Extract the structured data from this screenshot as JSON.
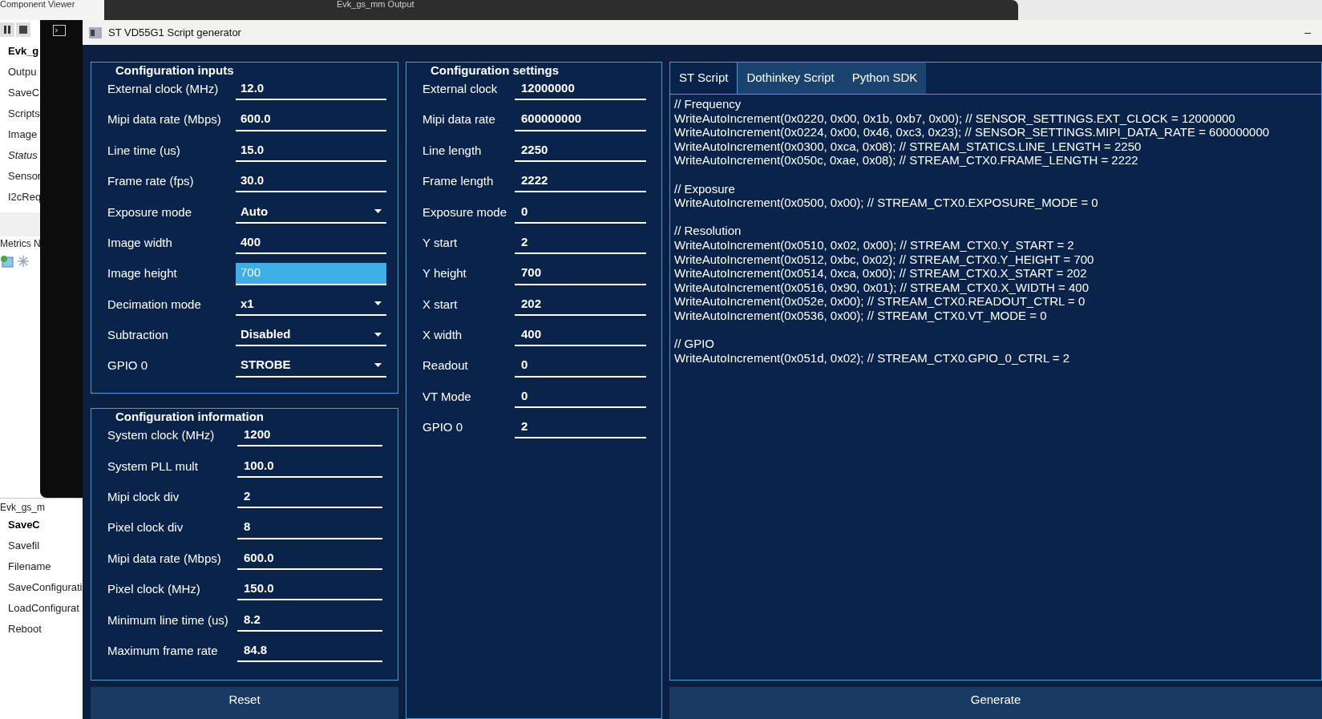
{
  "background_app": {
    "title": "Component Viewer",
    "output_title": "Evk_gs_mm Output",
    "tree_top": [
      {
        "label": "Evk_g",
        "kind": "group"
      },
      {
        "label": "Outpu",
        "kind": "item"
      },
      {
        "label": "SaveC",
        "kind": "item"
      },
      {
        "label": "Scripts",
        "kind": "item"
      },
      {
        "label": "Image",
        "kind": "item"
      },
      {
        "label": "Status",
        "kind": "italic"
      },
      {
        "label": "Sensor",
        "kind": "item"
      },
      {
        "label": "I2cReq",
        "kind": "item"
      }
    ],
    "metrics_title": "Metrics N",
    "tree_bottom_title": "Evk_gs_m",
    "tree_bottom": [
      {
        "label": "SaveC",
        "kind": "group"
      },
      {
        "label": "Savefil",
        "kind": "item"
      },
      {
        "label": "Filename",
        "kind": "item"
      },
      {
        "label": "SaveConfigurati",
        "kind": "item"
      },
      {
        "label": "LoadConfigurat",
        "kind": "item"
      },
      {
        "label": "Reboot",
        "kind": "item"
      }
    ]
  },
  "window": {
    "title": "ST VD55G1 Script generator",
    "minimize": "–"
  },
  "configuration_inputs": {
    "title": "Configuration inputs",
    "rows": [
      {
        "label": "External clock (MHz)",
        "value": "12.0",
        "kind": "text",
        "focused": false
      },
      {
        "label": "Mipi data rate (Mbps)",
        "value": "600.0",
        "kind": "text",
        "focused": false
      },
      {
        "label": "Line time (us)",
        "value": "15.0",
        "kind": "text",
        "focused": false
      },
      {
        "label": "Frame rate (fps)",
        "value": "30.0",
        "kind": "text",
        "focused": false
      },
      {
        "label": "Exposure mode",
        "value": "Auto",
        "kind": "dropdown",
        "focused": false
      },
      {
        "label": "Image width",
        "value": "400",
        "kind": "text",
        "focused": false
      },
      {
        "label": "Image height",
        "value": "700",
        "kind": "text",
        "focused": true
      },
      {
        "label": "Decimation mode",
        "value": "x1",
        "kind": "dropdown",
        "focused": false
      },
      {
        "label": "Subtraction",
        "value": "Disabled",
        "kind": "dropdown",
        "focused": false
      },
      {
        "label": "GPIO 0",
        "value": "STROBE",
        "kind": "dropdown",
        "focused": false
      }
    ]
  },
  "configuration_information": {
    "title": "Configuration information",
    "rows": [
      {
        "label": "System clock (MHz)",
        "value": "1200"
      },
      {
        "label": "System PLL mult",
        "value": "100.0"
      },
      {
        "label": "Mipi clock div",
        "value": "2"
      },
      {
        "label": "Pixel clock div",
        "value": "8"
      },
      {
        "label": "Mipi data rate (Mbps)",
        "value": "600.0"
      },
      {
        "label": "Pixel clock (MHz)",
        "value": "150.0"
      },
      {
        "label": "Minimum line time (us)",
        "value": "8.2"
      },
      {
        "label": "Maximum frame rate",
        "value": "84.8"
      }
    ]
  },
  "reset_button": "Reset",
  "configuration_settings": {
    "title": "Configuration settings",
    "rows": [
      {
        "label": "External clock",
        "value": "12000000"
      },
      {
        "label": "Mipi data rate",
        "value": "600000000"
      },
      {
        "label": "Line length",
        "value": "2250"
      },
      {
        "label": "Frame length",
        "value": "2222"
      },
      {
        "label": "Exposure mode",
        "value": "0"
      },
      {
        "label": "Y start",
        "value": "2"
      },
      {
        "label": "Y height",
        "value": "700"
      },
      {
        "label": "X start",
        "value": "202"
      },
      {
        "label": "X width",
        "value": "400"
      },
      {
        "label": "Readout",
        "value": "0"
      },
      {
        "label": "VT Mode",
        "value": "0"
      },
      {
        "label": "GPIO 0",
        "value": "2"
      }
    ]
  },
  "tabs": [
    {
      "label": "ST Script",
      "selected": true
    },
    {
      "label": "Dothinkey Script",
      "selected": false
    },
    {
      "label": "Python SDK",
      "selected": false
    }
  ],
  "script": [
    {
      "lines": [
        "// Frequency",
        "WriteAutoIncrement(0x0220, 0x00, 0x1b, 0xb7, 0x00); // SENSOR_SETTINGS.EXT_CLOCK = 12000000",
        "WriteAutoIncrement(0x0224, 0x00, 0x46, 0xc3, 0x23); // SENSOR_SETTINGS.MIPI_DATA_RATE = 600000000",
        "WriteAutoIncrement(0x0300, 0xca, 0x08); // STREAM_STATICS.LINE_LENGTH = 2250",
        "WriteAutoIncrement(0x050c, 0xae, 0x08); // STREAM_CTX0.FRAME_LENGTH = 2222"
      ]
    },
    {
      "lines": [
        "// Exposure",
        "WriteAutoIncrement(0x0500, 0x00); // STREAM_CTX0.EXPOSURE_MODE = 0"
      ]
    },
    {
      "lines": [
        "// Resolution",
        "WriteAutoIncrement(0x0510, 0x02, 0x00); // STREAM_CTX0.Y_START = 2",
        "WriteAutoIncrement(0x0512, 0xbc, 0x02); // STREAM_CTX0.Y_HEIGHT = 700",
        "WriteAutoIncrement(0x0514, 0xca, 0x00); // STREAM_CTX0.X_START = 202",
        "WriteAutoIncrement(0x0516, 0x90, 0x01); // STREAM_CTX0.X_WIDTH = 400",
        "WriteAutoIncrement(0x052e, 0x00); // STREAM_CTX0.READOUT_CTRL = 0",
        "WriteAutoIncrement(0x0536, 0x00); // STREAM_CTX0.VT_MODE = 0"
      ]
    },
    {
      "lines": [
        "// GPIO",
        "WriteAutoIncrement(0x051d, 0x02); // STREAM_CTX0.GPIO_0_CTRL = 2"
      ]
    }
  ],
  "generate_button": "Generate"
}
